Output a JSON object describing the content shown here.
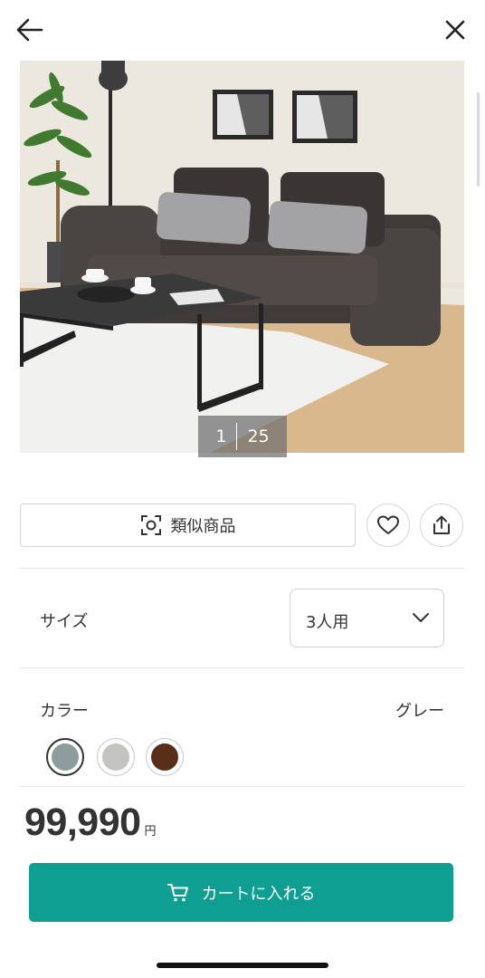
{
  "header": {
    "back_icon": "arrow-left-icon",
    "close_icon": "close-icon"
  },
  "gallery": {
    "current_index": "1",
    "total": "25"
  },
  "actions": {
    "similar_label": "類似商品",
    "similar_icon": "image-search-icon",
    "favorite_icon": "heart-icon",
    "share_icon": "share-icon"
  },
  "size": {
    "label": "サイズ",
    "selected": "3人用"
  },
  "color": {
    "label": "カラー",
    "selected_name": "グレー",
    "swatches": [
      {
        "name": "gray",
        "hex": "#8c9c9f",
        "selected": true
      },
      {
        "name": "light-gray",
        "hex": "#c4c5c1",
        "selected": false
      },
      {
        "name": "brown",
        "hex": "#5a2f1a",
        "selected": false
      }
    ]
  },
  "price": {
    "amount": "99,990",
    "unit": "円"
  },
  "cart": {
    "label": "カートに入れる",
    "icon": "cart-icon"
  },
  "colors": {
    "accent": "#0e9e92",
    "text": "#333333",
    "border": "#d6d6d6"
  }
}
